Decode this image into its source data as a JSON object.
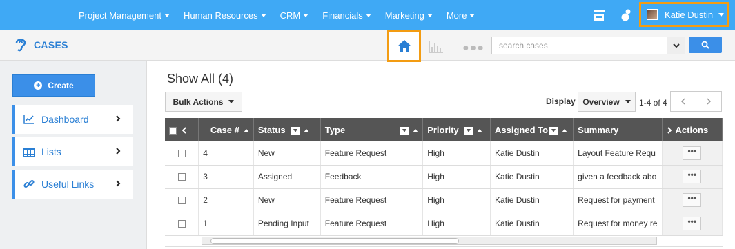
{
  "topnav": {
    "menu": [
      {
        "label": "Project Management",
        "name": "menu-project-management"
      },
      {
        "label": "Human Resources",
        "name": "menu-human-resources"
      },
      {
        "label": "CRM",
        "name": "menu-crm"
      },
      {
        "label": "Financials",
        "name": "menu-financials"
      },
      {
        "label": "Marketing",
        "name": "menu-marketing"
      },
      {
        "label": "More",
        "name": "menu-more"
      }
    ],
    "user_name": "Katie Dustin",
    "accent_color": "#3fa9f5",
    "highlight_color": "#f39c12"
  },
  "module": {
    "title": "CASES",
    "icon": "ear-icon"
  },
  "search": {
    "placeholder": "search cases"
  },
  "sidebar": {
    "create_label": "Create",
    "items": [
      {
        "label": "Dashboard",
        "icon": "line-chart-icon"
      },
      {
        "label": "Lists",
        "icon": "table-grid-icon"
      },
      {
        "label": "Useful Links",
        "icon": "link-icon"
      }
    ]
  },
  "main": {
    "show_all": "Show All (4)",
    "bulk_actions": "Bulk Actions",
    "display_label": "Display",
    "display_value": "Overview",
    "pager_info": "1-4 of 4"
  },
  "table": {
    "headers": {
      "case_num": "Case #",
      "status": "Status",
      "type": "Type",
      "priority": "Priority",
      "assigned_to": "Assigned To",
      "summary": "Summary",
      "actions": "Actions"
    },
    "rows": [
      {
        "case_num": "4",
        "status": "New",
        "type": "Feature Request",
        "priority": "High",
        "assigned_to": "Katie Dustin",
        "summary": "Layout Feature Requ"
      },
      {
        "case_num": "3",
        "status": "Assigned",
        "type": "Feedback",
        "priority": "High",
        "assigned_to": "Katie Dustin",
        "summary": "given a feedback abo"
      },
      {
        "case_num": "2",
        "status": "New",
        "type": "Feature Request",
        "priority": "High",
        "assigned_to": "Katie Dustin",
        "summary": "Request for payment"
      },
      {
        "case_num": "1",
        "status": "Pending Input",
        "type": "Feature Request",
        "priority": "High",
        "assigned_to": "Katie Dustin",
        "summary": "Request for money re"
      }
    ],
    "action_label": "•••"
  }
}
